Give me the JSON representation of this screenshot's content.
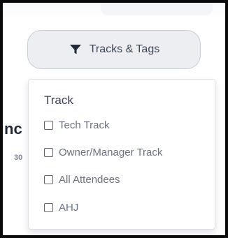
{
  "filter_button": {
    "label": "Tracks & Tags",
    "icon": "filter-funnel-icon"
  },
  "background": {
    "partial_heading": "nc",
    "partial_text": "30"
  },
  "dropdown": {
    "heading": "Track",
    "options": [
      {
        "label": "Tech Track",
        "checked": false
      },
      {
        "label": "Owner/Manager Track",
        "checked": false
      },
      {
        "label": "All Attendees",
        "checked": false
      },
      {
        "label": "AHJ",
        "checked": false
      }
    ]
  },
  "colors": {
    "button_bg": "#eceef1",
    "button_border": "#c9ced6",
    "text_primary": "#3a4252",
    "text_option": "#6a7180"
  }
}
